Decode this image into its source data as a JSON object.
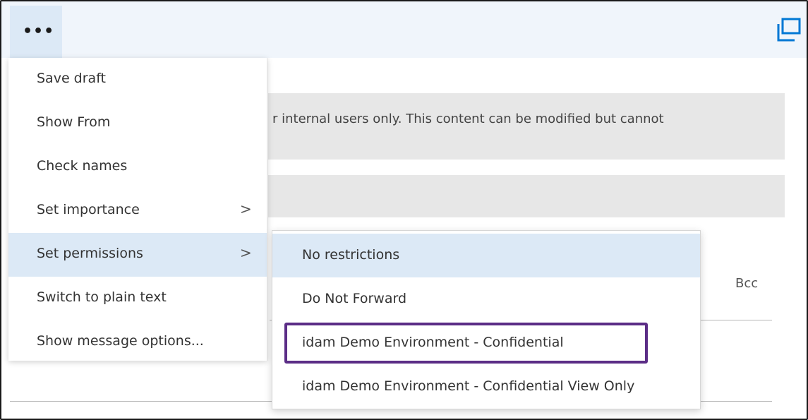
{
  "toolbar": {
    "more_label": "•••",
    "more_icon": "more-dots-icon",
    "popout_icon": "popout-window-icon",
    "accent_color": "#0078d4"
  },
  "compose": {
    "banner_text": "r internal users only. This content can be modified but cannot",
    "bcc_label": "Bcc"
  },
  "menu": {
    "items": [
      {
        "label": "Save draft"
      },
      {
        "label": "Show From"
      },
      {
        "label": "Check names"
      },
      {
        "label": "Set importance",
        "chevron": ">"
      },
      {
        "label": "Set permissions",
        "chevron": ">"
      },
      {
        "label": "Switch to plain text"
      },
      {
        "label": "Show message options..."
      }
    ],
    "active_index": 4
  },
  "submenu": {
    "items": [
      {
        "label": "No restrictions"
      },
      {
        "label": "Do Not Forward"
      },
      {
        "label": "idam Demo Environment - Confidential"
      },
      {
        "label": "idam Demo Environment - Confidential View Only"
      }
    ],
    "active_index": 0,
    "highlighted_index": 2,
    "highlight_color": "#5b2d86",
    "selection_color": "#dce9f6"
  }
}
